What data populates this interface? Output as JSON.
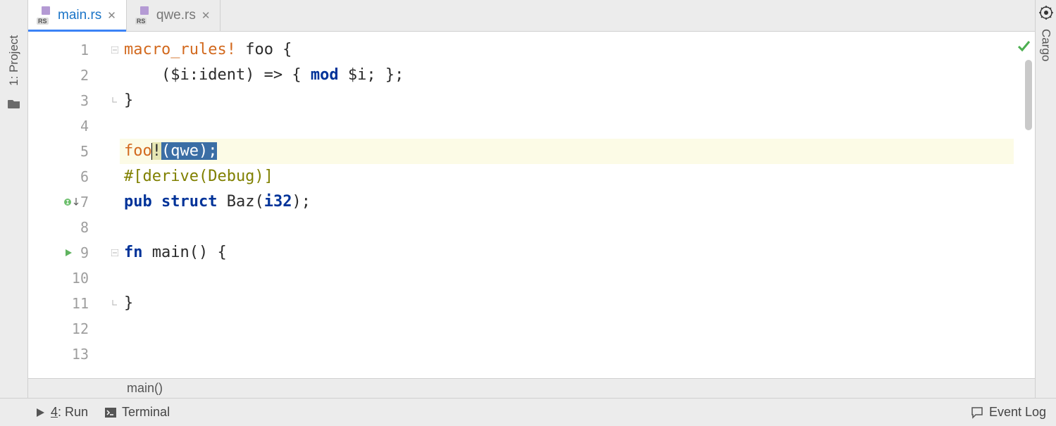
{
  "left_tool": {
    "project_label": "1: Project"
  },
  "right_tool": {
    "cargo_label": "Cargo"
  },
  "tabs": [
    {
      "label": "main.rs",
      "active": true
    },
    {
      "label": "qwe.rs",
      "active": false
    }
  ],
  "gutter": {
    "lines": [
      "1",
      "2",
      "3",
      "4",
      "5",
      "6",
      "7",
      "8",
      "9",
      "10",
      "11",
      "12",
      "13"
    ]
  },
  "code": {
    "l1_a": "macro_rules!",
    "l1_b": " foo {",
    "l2_a": "    ($i:ident) => { ",
    "l2_b": "mod",
    "l2_c": " $i; };",
    "l3": "}",
    "l4": "",
    "l5_a": "foo",
    "l5_b": "!",
    "l5_sel": "(qwe);",
    "l6_a": "#[derive(Debug)]",
    "l7_a": "pub",
    "l7_b": " ",
    "l7_c": "struct",
    "l7_d": " Baz(",
    "l7_e": "i32",
    "l7_f": ");",
    "l8": "",
    "l9_a": "fn",
    "l9_b": " main() {",
    "l10": "",
    "l11": "}",
    "l12": "",
    "l13": ""
  },
  "breadcrumb": {
    "text": "main()"
  },
  "status": {
    "run_label_u": "4",
    "run_label_rest": ": Run",
    "terminal_label": "Terminal",
    "event_log_label": "Event Log"
  },
  "icons": {
    "close": "✕"
  }
}
